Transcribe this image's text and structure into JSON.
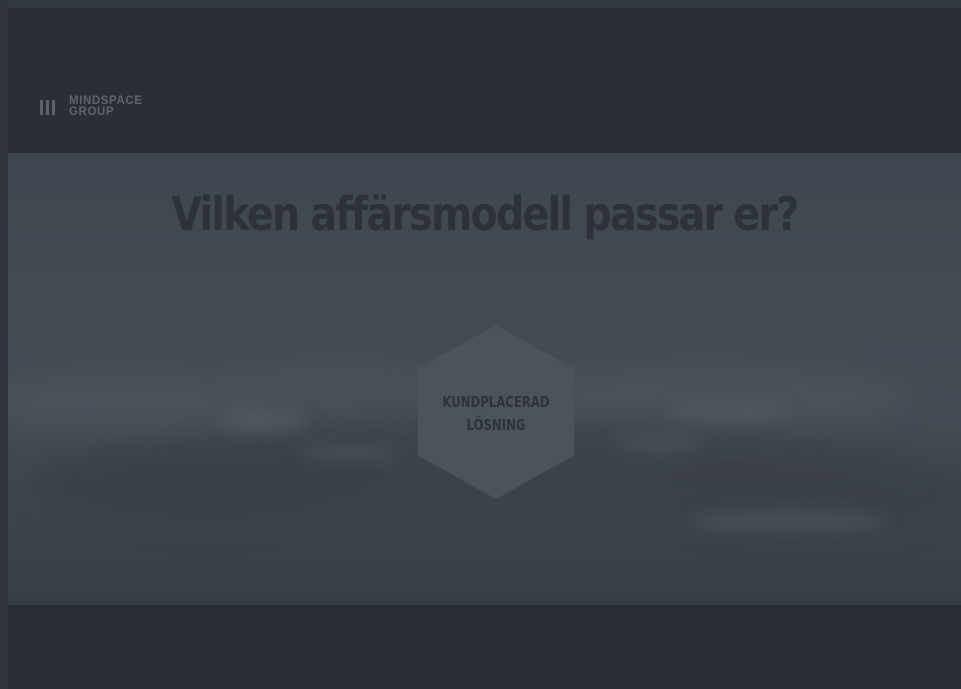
{
  "header": {
    "logo": {
      "icon": "three-bars-icon",
      "line1": "MINDSPACE",
      "line2": "GROUP"
    }
  },
  "hero": {
    "title": "Vilken affärsmodell passar er?",
    "option": {
      "line1": "KUNDPLACERAD",
      "line2": "LÖSNING"
    }
  },
  "colors": {
    "background": "#2b3037",
    "header": "#2a2f35",
    "hero_tint": "#434a52",
    "hex_fill": "#4d535b",
    "text_dark": "#2d3239",
    "logo_gray": "#5f646b"
  }
}
